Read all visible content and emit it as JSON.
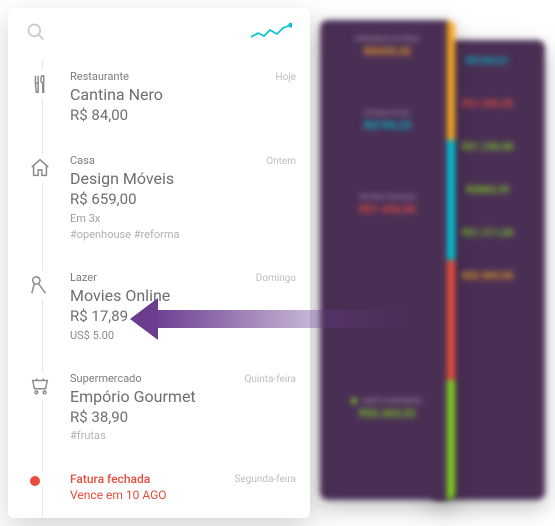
{
  "header": {},
  "feed": [
    {
      "category": "Restaurante",
      "title": "Cantina Nero",
      "amount": "R$ 84,00",
      "day": "Hoje"
    },
    {
      "category": "Casa",
      "title": "Design Móveis",
      "amount": "R$ 659,00",
      "meta": "Em 3x",
      "tags": "#openhouse  #reforma",
      "day": "Ontem"
    },
    {
      "category": "Lazer",
      "title": "Movies Online",
      "amount": "R$ 17,89",
      "usd": "US$ 5.00",
      "day": "Domingo"
    },
    {
      "category": "Supermercado",
      "title": "Empório Gourmet",
      "amount": "R$ 38,90",
      "tags": "#frutas",
      "day": "Quinta-feira"
    }
  ],
  "closing": {
    "label": "Fatura fechada",
    "due": "Vence em 10 AGO",
    "day": "Segunda-feira"
  },
  "card1": {
    "r1_label": "PRÓXIMAS FATURAS",
    "r1_value": "R$439,32",
    "r2_label": "FATURA ATUAL",
    "r2_value": "R$799,25",
    "r3_label": "FATURA FECHADA",
    "r3_value": "R$1.096,90",
    "r4_label": "LIMITE DISPONÍVEL",
    "r4_value": "R$2.663,52"
  },
  "card2": {
    "v1": "R$169,61",
    "v2": "R$1.096,90",
    "v3": "R$1.240,08",
    "v4": "R$884,39",
    "v5": "R$1.211,60",
    "v6": "R$2.069,00"
  },
  "colors": {
    "orange": "#f5a623",
    "cyan": "#00c2d1",
    "red": "#e74c3c",
    "green": "#7ed321"
  }
}
